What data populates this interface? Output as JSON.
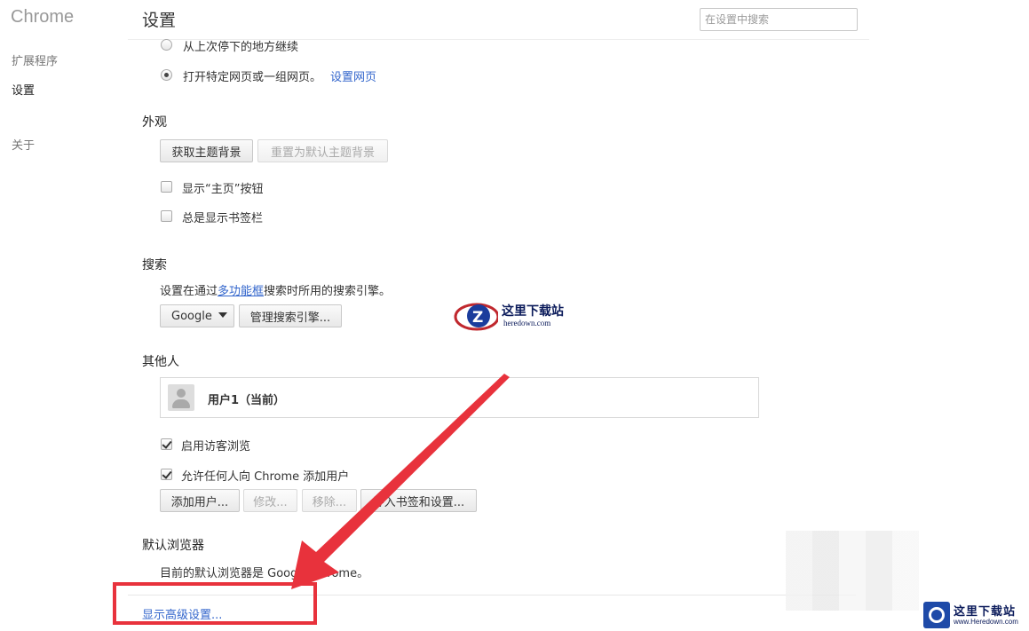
{
  "sidebar": {
    "brand": "Chrome",
    "items": [
      {
        "label": "扩展程序"
      },
      {
        "label": "设置"
      },
      {
        "label": "关于"
      }
    ]
  },
  "header": {
    "title": "设置",
    "search_placeholder": "在设置中搜索"
  },
  "startup": {
    "option_continue": "从上次停下的地方继续",
    "option_specific": "打开特定网页或一组网页。",
    "set_pages_link": "设置网页"
  },
  "appearance": {
    "title": "外观",
    "get_themes": "获取主题背景",
    "reset_theme": "重置为默认主题背景",
    "show_home": "显示“主页”按钮",
    "show_bookmarks": "总是显示书签栏"
  },
  "search": {
    "title": "搜索",
    "desc_prefix": "设置在通过",
    "desc_link": "多功能框",
    "desc_suffix": "搜索时所用的搜索引擎。",
    "engine": "Google",
    "manage": "管理搜索引擎..."
  },
  "people": {
    "title": "其他人",
    "user": "用户1（当前）",
    "guest": "启用访客浏览",
    "allow_add": "允许任何人向 Chrome 添加用户",
    "add": "添加用户...",
    "edit": "修改...",
    "remove": "移除...",
    "import": "导入书签和设置..."
  },
  "default_browser": {
    "title": "默认浏览器",
    "status": "目前的默认浏览器是 Google Chrome。"
  },
  "advanced_link": "显示高级设置...",
  "watermark": {
    "center_cn": "这里下载站",
    "center_en": "heredown.com",
    "corner_cn": "这里下载站",
    "corner_en": "www.Heredown.com"
  },
  "colors": {
    "arrow": "#e8323c",
    "link": "#3366cc"
  }
}
